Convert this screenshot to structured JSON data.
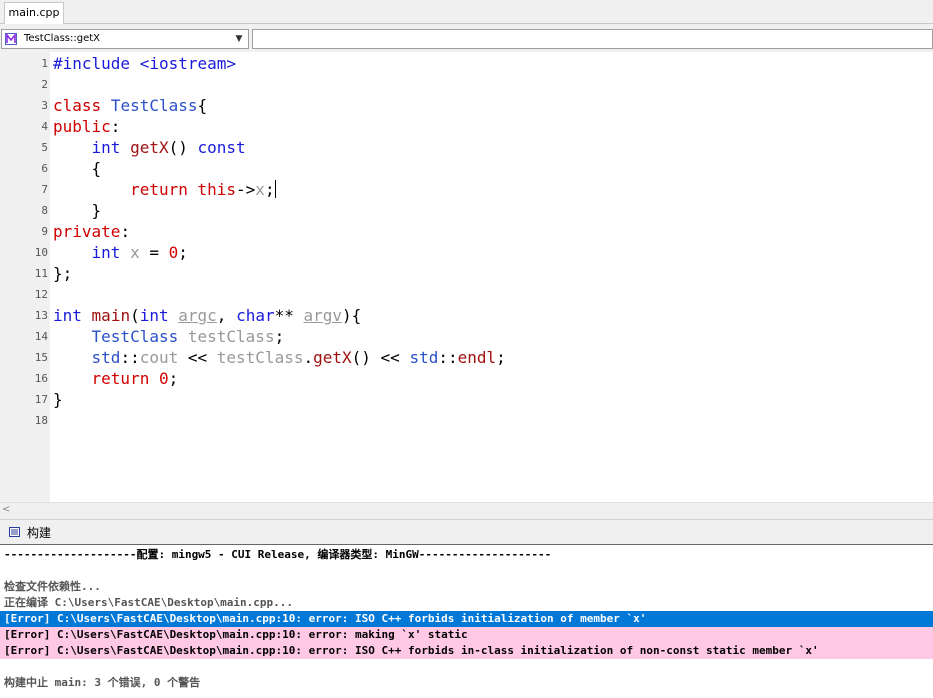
{
  "tab": {
    "label": "main.cpp"
  },
  "symbol_combo": {
    "value": "TestClass::getX",
    "icon": "class-member-icon"
  },
  "editor": {
    "line_numbers": [
      "1",
      "2",
      "3",
      "4",
      "5",
      "6",
      "7",
      "8",
      "9",
      "10",
      "11",
      "12",
      "13",
      "14",
      "15",
      "16",
      "17",
      "18"
    ],
    "tokens": {
      "include": "#include <iostream>",
      "class_kw": "class",
      "class_name": "TestClass",
      "brace_open": "{",
      "public_kw": "public",
      "colon": ":",
      "int_kw": "int",
      "getx": "getX",
      "parens": "()",
      "const_kw": "const",
      "return_kw": "return",
      "this_kw": "this",
      "arrow": "->",
      "x": "x",
      "semi": ";",
      "brace_close": "}",
      "private_kw": "private",
      "eq": " = ",
      "zero": "0",
      "close_class": "};",
      "main": "main",
      "lparen": "(",
      "argc": "argc",
      "comma": ", ",
      "char_kw": "char",
      "stars": "**",
      "argv": "argv",
      "rparen_brace": "){",
      "test_var": "testClass",
      "std": "std",
      "scope": "::",
      "cout": "cout",
      "shift": " << ",
      "dot": ".",
      "endl": "endl"
    }
  },
  "build_panel": {
    "title": "构建",
    "icon": "build-output-icon",
    "lines": [
      {
        "text": "--------------------配置: mingw5 - CUI Release, 编译器类型: MinGW--------------------",
        "style": "dark"
      },
      {
        "text": "",
        "style": "dark"
      },
      {
        "text": "检查文件依赖性...",
        "style": "gray"
      },
      {
        "text": "正在编译 C:\\Users\\FastCAE\\Desktop\\main.cpp...",
        "style": "gray"
      },
      {
        "text": "[Error] C:\\Users\\FastCAE\\Desktop\\main.cpp:10: error: ISO C++ forbids initialization of member `x'",
        "style": "selected"
      },
      {
        "text": "[Error] C:\\Users\\FastCAE\\Desktop\\main.cpp:10: error: making `x' static",
        "style": "error"
      },
      {
        "text": "[Error] C:\\Users\\FastCAE\\Desktop\\main.cpp:10: error: ISO C++ forbids in-class initialization of non-const static member `x'",
        "style": "error"
      },
      {
        "text": "",
        "style": "dark"
      },
      {
        "text": "构建中止 main: 3 个错误, 0 个警告",
        "style": "gray"
      }
    ]
  },
  "colors": {
    "keyword_red": "#d00000",
    "keyword_blue": "#1a1adb",
    "class_blue": "#2a50c8",
    "selection": "#0078d7",
    "error_bg": "#ffc8e4"
  }
}
